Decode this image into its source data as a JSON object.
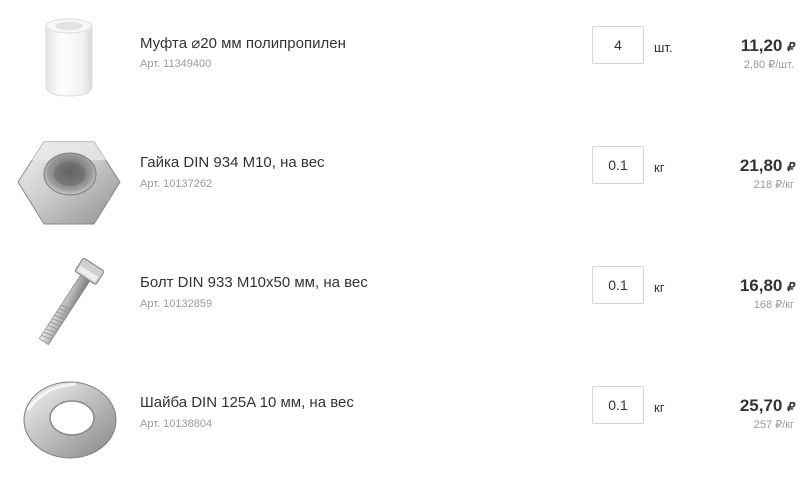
{
  "items": [
    {
      "name": "Муфта ⌀20 мм полипропилен",
      "article": "Арт. 11349400",
      "quantity": "4",
      "unit": "шт.",
      "price": "11,20",
      "currency": "₽",
      "unit_price": "2,80 ₽/шт.",
      "icon": "coupling-icon"
    },
    {
      "name": "Гайка DIN 934 М10, на вес",
      "article": "Арт. 10137262",
      "quantity": "0.1",
      "unit": "кг",
      "price": "21,80",
      "currency": "₽",
      "unit_price": "218 ₽/кг",
      "icon": "hex-nut-icon"
    },
    {
      "name": "Болт DIN 933 М10х50 мм, на вес",
      "article": "Арт. 10132859",
      "quantity": "0.1",
      "unit": "кг",
      "price": "16,80",
      "currency": "₽",
      "unit_price": "168 ₽/кг",
      "icon": "bolt-icon"
    },
    {
      "name": "Шайба DIN 125A 10 мм, на вес",
      "article": "Арт. 10138804",
      "quantity": "0.1",
      "unit": "кг",
      "price": "25,70",
      "currency": "₽",
      "unit_price": "257 ₽/кг",
      "icon": "washer-icon"
    }
  ]
}
